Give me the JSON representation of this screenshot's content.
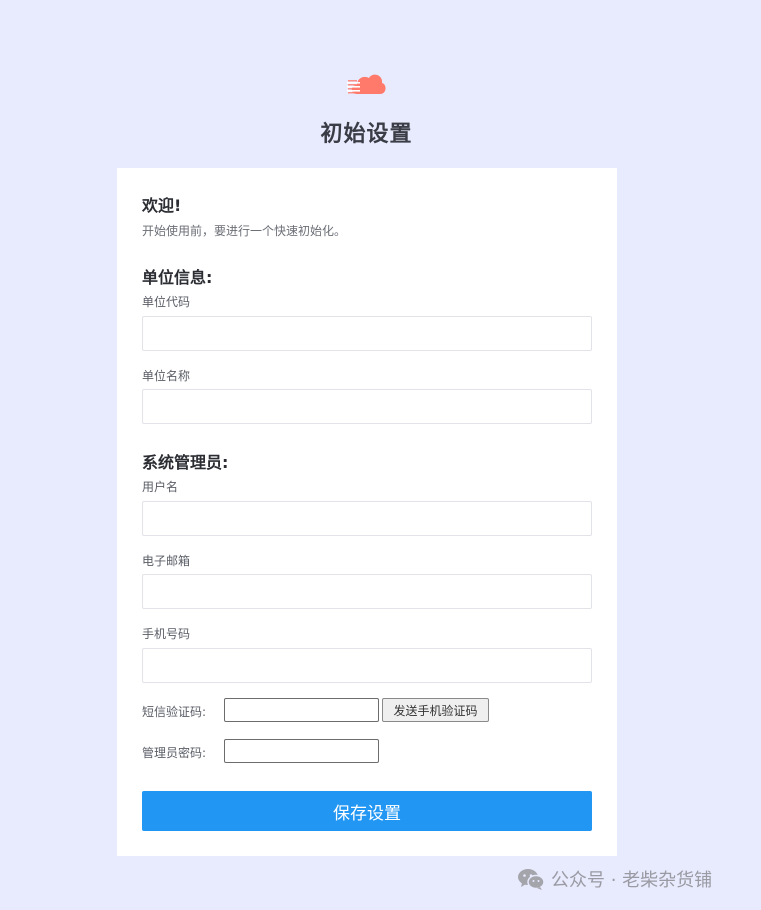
{
  "header": {
    "logo_icon": "cloud-icon",
    "title": "初始设置"
  },
  "colors": {
    "background": "#e8eafe",
    "logo": "#ff7a6b",
    "primary_button": "#2196f3"
  },
  "welcome": {
    "title": "欢迎!",
    "text": "开始使用前，要进行一个快速初始化。"
  },
  "org_section": {
    "title": "单位信息:",
    "code_label": "单位代码",
    "code_value": "",
    "name_label": "单位名称",
    "name_value": ""
  },
  "admin_section": {
    "title": "系统管理员:",
    "username_label": "用户名",
    "username_value": "",
    "email_label": "电子邮箱",
    "email_value": "",
    "phone_label": "手机号码",
    "phone_value": "",
    "sms_code_label": "短信验证码:",
    "sms_code_value": "",
    "send_sms_button": "发送手机验证码",
    "password_label": "管理员密码:",
    "password_value": ""
  },
  "actions": {
    "save_label": "保存设置"
  },
  "watermark": {
    "icon": "wechat-icon",
    "text": "公众号 · 老柴杂货铺"
  }
}
